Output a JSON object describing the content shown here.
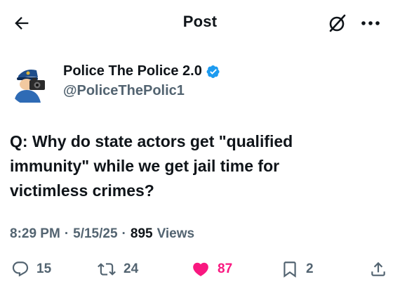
{
  "header": {
    "title": "Post",
    "back_icon": "back-arrow-icon",
    "grok_icon": "grok-icon",
    "more_icon": "more-dots-icon"
  },
  "author": {
    "display_name": "Police The Police 2.0",
    "handle": "@PoliceThePolic1",
    "verified": true,
    "verified_color": "#1d9bf0",
    "avatar": "police-officer-with-camera-avatar"
  },
  "post": {
    "text": "Q: Why do state actors get \"qualified\nimmunity\" while we get jail time for\nvictimless crimes?"
  },
  "meta": {
    "time": "8:29 PM",
    "date": "5/15/25",
    "views_count": "895",
    "views_label": "Views",
    "separator": "·"
  },
  "actions": {
    "replies": "15",
    "reposts": "24",
    "likes": "87",
    "liked": true,
    "like_color": "#f91880",
    "bookmarks": "2"
  }
}
